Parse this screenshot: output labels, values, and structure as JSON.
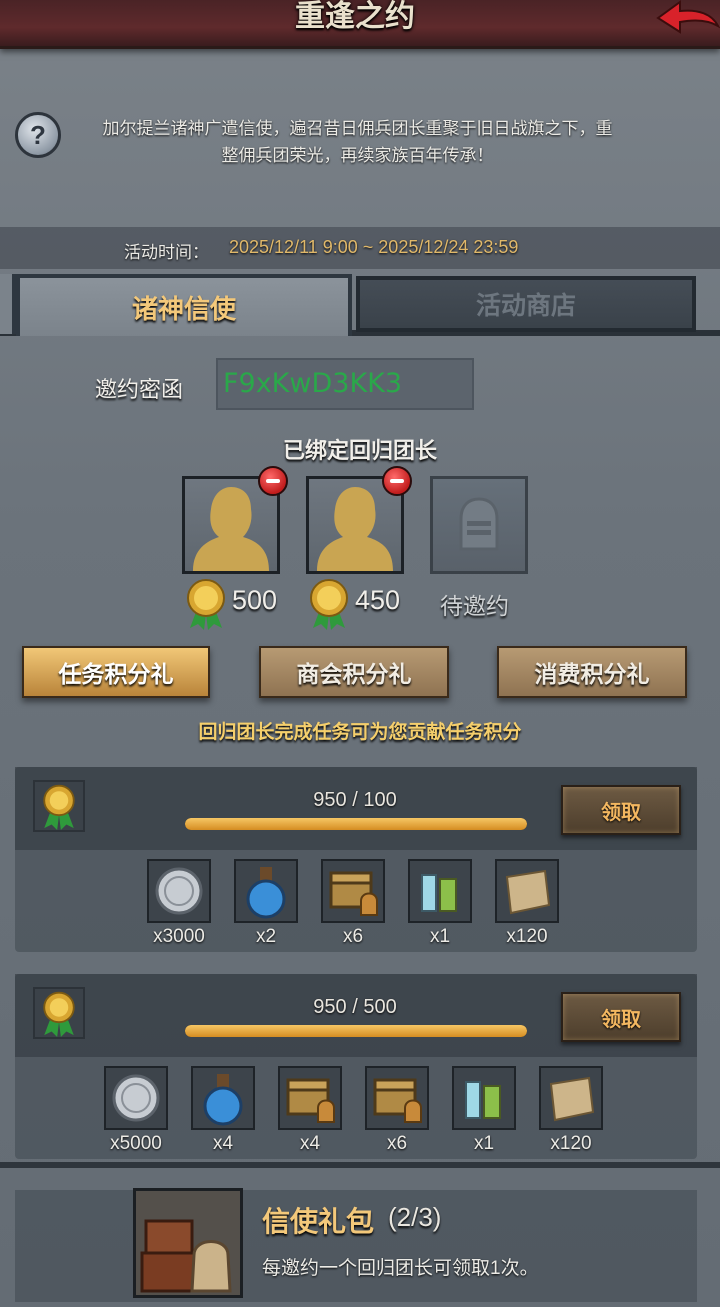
{
  "header": {
    "title": "重逢之约",
    "back_icon": "back-arrow-icon"
  },
  "intro": {
    "line1": "加尔提兰诸神广遣信使，遍召昔日佣兵团长重聚于旧日战旗之下，重",
    "line2": "整佣兵团荣光，再续家族百年传承！",
    "help_icon": "question-icon"
  },
  "event_time": {
    "label": "活动时间：",
    "value": "2025/12/11 9:00 ~ 2025/12/24 23:59"
  },
  "tabs": [
    {
      "label": "诸神信使",
      "active": true
    },
    {
      "label": "活动商店",
      "active": false
    }
  ],
  "invite": {
    "label": "邀约密函",
    "code": "F9xKwD3KK3"
  },
  "bound": {
    "title": "已绑定回归团长",
    "slots": [
      {
        "status": "bound",
        "score": "500"
      },
      {
        "status": "bound",
        "score": "450"
      },
      {
        "status": "pending",
        "label": "待邀约"
      }
    ]
  },
  "gift_tabs": [
    {
      "label": "任务积分礼",
      "active": true
    },
    {
      "label": "商会积分礼",
      "active": false
    },
    {
      "label": "消费积分礼",
      "active": false
    }
  ],
  "hint": "回归团长完成任务可为您贡献任务积分",
  "rewards": [
    {
      "progress": "950 / 100",
      "fill_fraction": 1.0,
      "claim_label": "领取",
      "items": [
        {
          "icon": "silver-coin-icon",
          "qty": "x3000"
        },
        {
          "icon": "blue-potion-icon",
          "qty": "x2"
        },
        {
          "icon": "treasure-chest-icon",
          "qty": "x6"
        },
        {
          "icon": "vials-icon",
          "qty": "x1"
        },
        {
          "icon": "scroll-icon",
          "qty": "x120"
        }
      ]
    },
    {
      "progress": "950 / 500",
      "fill_fraction": 1.0,
      "claim_label": "领取",
      "items": [
        {
          "icon": "silver-coin-icon",
          "qty": "x5000"
        },
        {
          "icon": "blue-potion-icon",
          "qty": "x4"
        },
        {
          "icon": "treasure-chest-icon",
          "qty": "x4"
        },
        {
          "icon": "treasure-chest-icon",
          "qty": "x6"
        },
        {
          "icon": "vials-icon",
          "qty": "x1"
        },
        {
          "icon": "scroll-icon",
          "qty": "x120"
        }
      ]
    }
  ],
  "pack": {
    "title": "信使礼包",
    "count": "(2/3)",
    "desc": "每邀约一个回归团长可领取1次。",
    "icon": "crates-and-sack-icon"
  },
  "colors": {
    "accent": "#f3c87a",
    "code_green": "#2aa84a",
    "header_red": "#5f2a2c"
  }
}
